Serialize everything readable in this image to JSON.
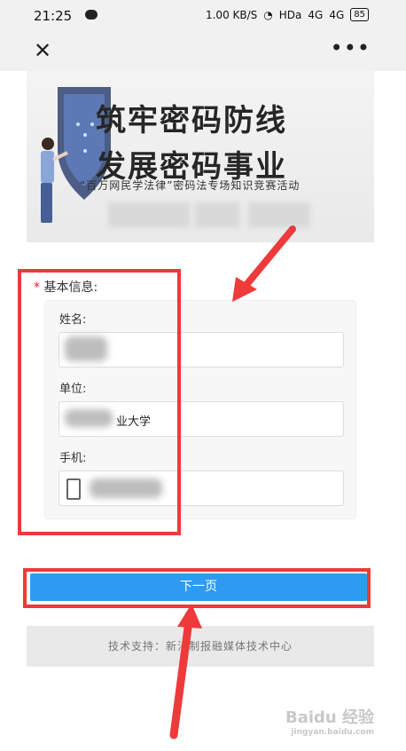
{
  "status_bar": {
    "time": "21:25",
    "network_speed": "1.00 KB/S",
    "hd": "HDa",
    "signal1": "4G",
    "signal2": "4G",
    "battery": "85"
  },
  "navbar": {
    "close_icon": "close-icon",
    "more_icon": "more-icon"
  },
  "banner": {
    "title_line1": "筑牢密码防线",
    "title_line2": "发展密码事业",
    "subtitle": "“百万网民学法律”密码法专场知识竞赛活动"
  },
  "form": {
    "section_required_mark": "*",
    "section_title": "基本信息:",
    "name_label": "姓名:",
    "unit_label": "单位:",
    "unit_value": "业大学",
    "phone_label": "手机:"
  },
  "buttons": {
    "next_label": "下一页"
  },
  "footer": {
    "support_text": "技术支持：新法制报融媒体技术中心"
  },
  "watermark": {
    "brand": "Baidu 经验",
    "url": "jingyan.baidu.com"
  },
  "colors": {
    "primary": "#2d9cf0",
    "annotation_red": "#ee3a3a"
  }
}
